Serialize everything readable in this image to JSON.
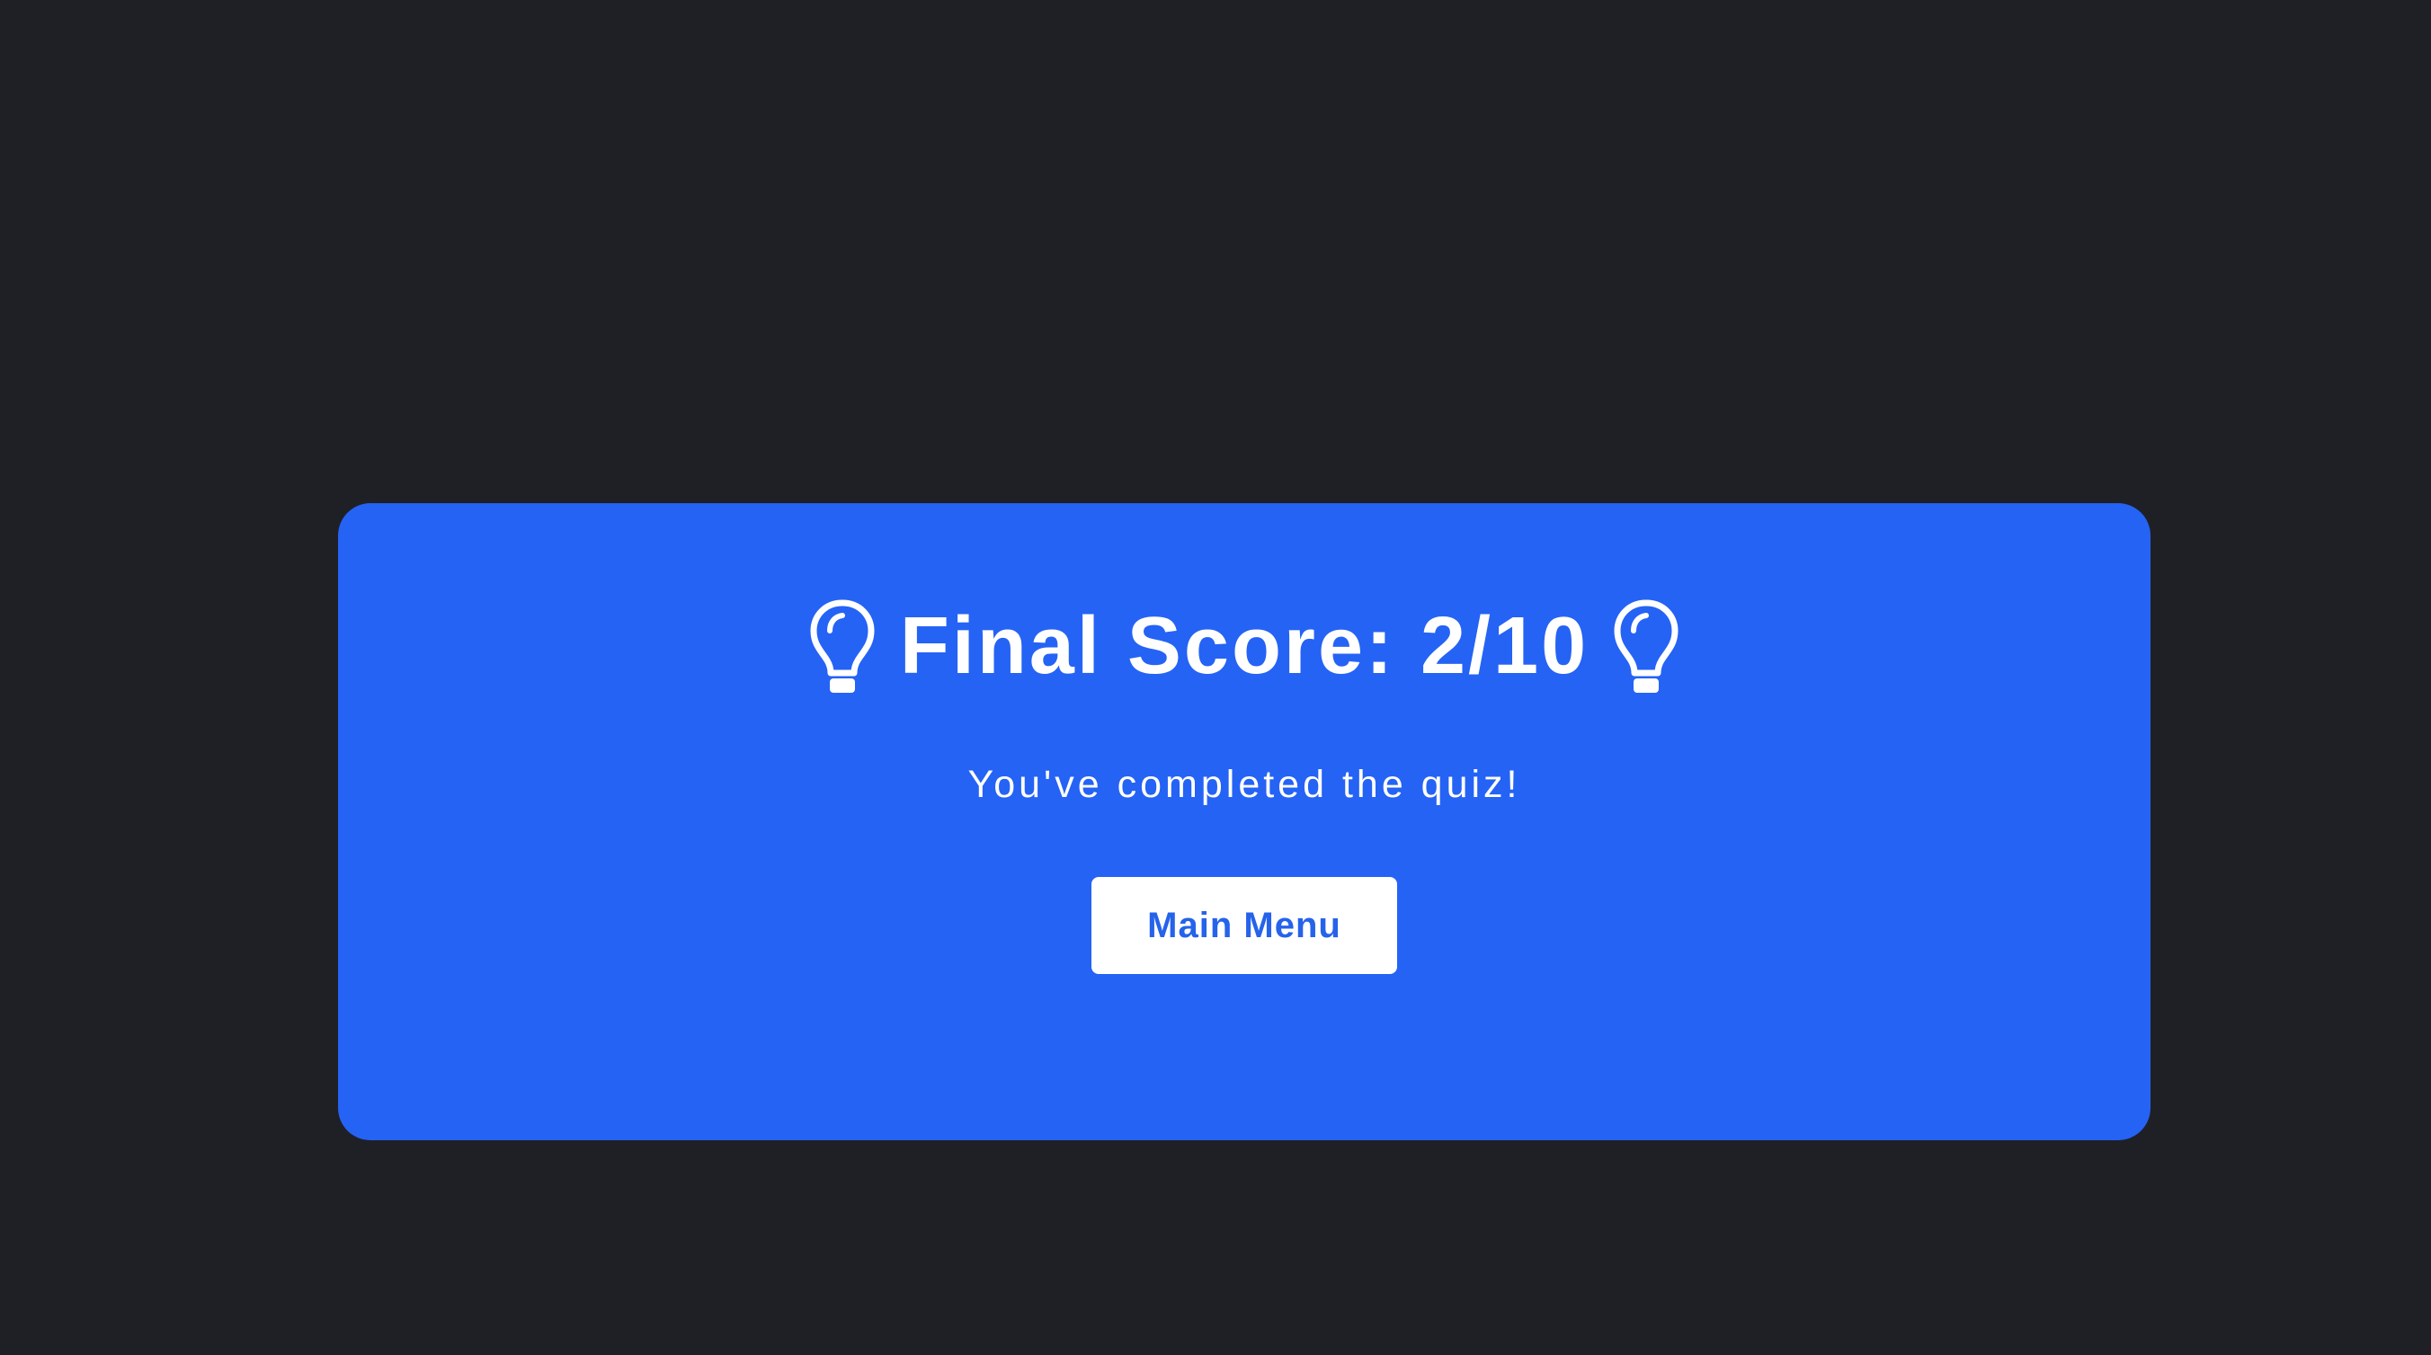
{
  "result": {
    "title": "Final Score: 2/10",
    "score": 2,
    "total": 10,
    "message": "You've completed the quiz!",
    "main_menu_label": "Main Menu",
    "left_icon": "lightbulb-icon",
    "right_icon": "lightbulb-icon"
  },
  "colors": {
    "background": "#1f2025",
    "card": "#2563f5",
    "text": "#ffffff",
    "button_bg": "#ffffff",
    "button_text": "#2563eb"
  }
}
